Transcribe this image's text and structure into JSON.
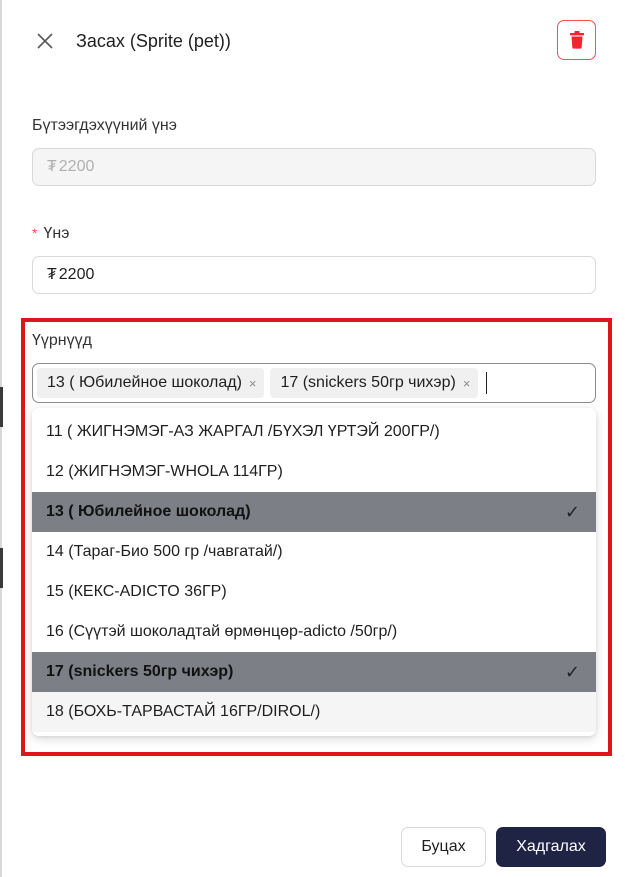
{
  "header": {
    "title": "Засах (Sprite (pet))"
  },
  "fields": {
    "cost_price": {
      "label": "Бүтээгдэхүүний үнэ",
      "currency": "₮",
      "value": "2200"
    },
    "price": {
      "required_mark": "*",
      "label": "Үнэ",
      "currency": "₮",
      "value": "2200"
    },
    "tags": {
      "label": "Үүрнүүд",
      "selected": [
        "13 ( Юбилейное шоколад)",
        "17 (snickers 50гр чихэр)"
      ],
      "remove_symbol": "×"
    }
  },
  "dropdown": {
    "check_symbol": "✓",
    "options": [
      {
        "label": "11 ( ЖИГНЭМЭГ-АЗ ЖАРГАЛ /БҮХЭЛ ҮРТЭЙ 200ГР/)"
      },
      {
        "label": "12 (ЖИГНЭМЭГ-WHOLA 114ГР)"
      },
      {
        "label": "13 ( Юбилейное шоколад)"
      },
      {
        "label": "14 (Тараг-Био 500 гр /чавгатай/)"
      },
      {
        "label": "15 (КЕКС-ADICTO 36ГР)"
      },
      {
        "label": "16 (Сүүтэй шоколадтай өрмөнцөр-adicto /50гр/)"
      },
      {
        "label": "17 (snickers 50гр чихэр)"
      },
      {
        "label": "18 (БОХЬ-ТАРВАСТАЙ 16ГР/DIROL/)"
      }
    ]
  },
  "footer": {
    "back_label": "Буцах",
    "save_label": "Хадгалах"
  },
  "colors": {
    "danger": "#ff4d4f",
    "highlight_border": "#e0141e",
    "selected_option_bg": "#7c7f86",
    "primary_button": "#1f2444"
  },
  "icons": [
    "close-icon",
    "trash-icon",
    "check-icon",
    "remove-tag-icon"
  ]
}
